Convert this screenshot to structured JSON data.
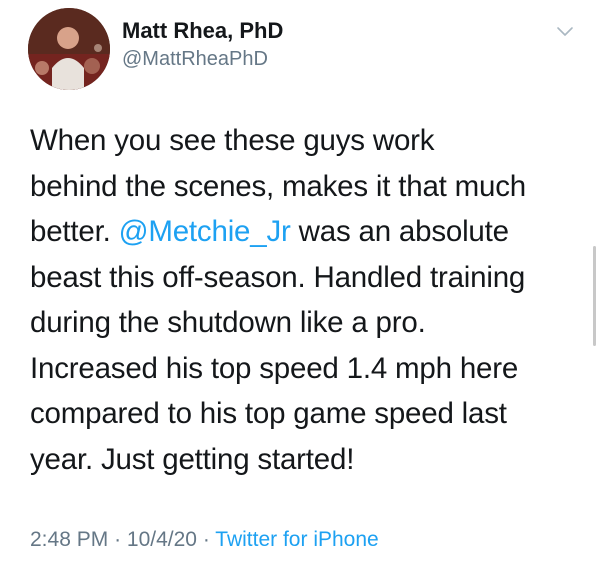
{
  "author": {
    "name": "Matt Rhea, PhD",
    "handle": "@MattRheaPhD"
  },
  "tweet": {
    "lines": [
      "When you see these guys work",
      "behind the scenes, makes it that much",
      "better.",
      "was an absolute",
      "beast this off-season. Handled training",
      "during the shutdown like a pro.",
      "Increased his top speed 1.4 mph here",
      "compared to his top game speed last",
      "year. Just getting started!"
    ],
    "mention": "@Metchie_Jr"
  },
  "meta": {
    "time": "2:48 PM",
    "date": "10/4/20",
    "separator": "·",
    "source": "Twitter for iPhone"
  },
  "colors": {
    "link": "#1da1f2",
    "secondary_text": "#657786",
    "primary_text": "#14171a"
  },
  "icons": {
    "menu": "chevron-down-icon"
  }
}
